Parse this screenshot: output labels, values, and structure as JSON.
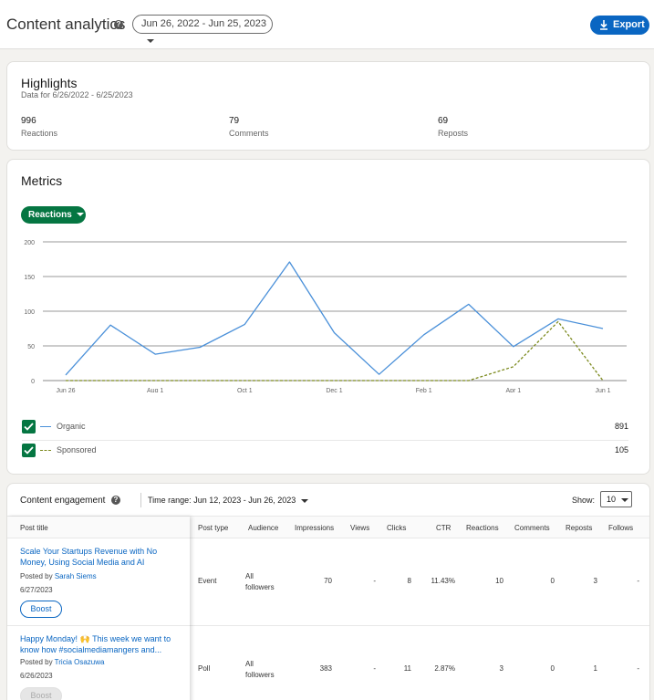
{
  "header": {
    "title": "Content analytics",
    "date_range": "Jun 26, 2022 - Jun 25, 2023",
    "export_label": "Export"
  },
  "highlights": {
    "title": "Highlights",
    "subtitle": "Data for 6/26/2022 - 6/25/2023",
    "stats": [
      {
        "value": "996",
        "label": "Reactions"
      },
      {
        "value": "79",
        "label": "Comments"
      },
      {
        "value": "69",
        "label": "Reposts"
      }
    ]
  },
  "metrics": {
    "title": "Metrics",
    "selected_metric": "Reactions",
    "legend": [
      {
        "name": "Organic",
        "total": "891",
        "color": "#4a90d9",
        "checked": true
      },
      {
        "name": "Sponsored",
        "total": "105",
        "color": "#7c8a1e",
        "checked": true
      }
    ]
  },
  "chart_data": {
    "type": "line",
    "ylim": [
      0,
      200
    ],
    "yticks": [
      0,
      50,
      100,
      150,
      200
    ],
    "x_tick_labels": [
      "Jun 26",
      "Aug 1",
      "Oct 1",
      "Dec 1",
      "Feb 1",
      "Apr 1",
      "Jun 1"
    ],
    "x_tick_positions": [
      0,
      2,
      4,
      6,
      8,
      10,
      12
    ],
    "series": [
      {
        "name": "Organic",
        "color": "#4a90d9",
        "dash": false,
        "x": [
          0,
          1,
          2,
          3,
          4,
          5,
          6,
          7,
          8,
          9,
          10,
          11,
          12
        ],
        "values": [
          8,
          80,
          38,
          48,
          81,
          171,
          69,
          9,
          66,
          110,
          49,
          89,
          75
        ]
      },
      {
        "name": "Sponsored",
        "color": "#7c8a1e",
        "dash": true,
        "x": [
          0,
          1,
          2,
          3,
          4,
          5,
          6,
          7,
          8,
          9,
          10,
          11,
          12
        ],
        "values": [
          0,
          0,
          0,
          0,
          0,
          0,
          0,
          0,
          0,
          0,
          20,
          85,
          0
        ]
      }
    ]
  },
  "engagement": {
    "title": "Content engagement",
    "time_range_label": "Time range:",
    "time_range": "Jun 12, 2023 - Jun 26, 2023",
    "show_label": "Show:",
    "show_value": "10",
    "columns": [
      "Post title",
      "Post type",
      "Audience",
      "Impressions",
      "Views",
      "Clicks",
      "CTR",
      "Reactions",
      "Comments",
      "Reposts",
      "Follows"
    ],
    "rows": [
      {
        "title": "Scale Your Startups Revenue with No Money, Using Social Media and AI",
        "posted_by_label": "Posted by",
        "author": "Sarah Siems",
        "date": "6/27/2023",
        "boost": "Boost",
        "type": "Event",
        "audience": "All followers",
        "impressions": "70",
        "views": "-",
        "clicks": "8",
        "ctr": "11.43%",
        "reactions": "10",
        "comments": "0",
        "reposts": "3",
        "follows": "-"
      },
      {
        "title": "Happy Monday! 🙌 This week we want to know how #socialmediamangers and...",
        "posted_by_label": "Posted by",
        "author": "Tricia Osazuwa",
        "date": "6/26/2023",
        "boost": "Boost",
        "type": "Poll",
        "audience": "All followers",
        "impressions": "383",
        "views": "-",
        "clicks": "11",
        "ctr": "2.87%",
        "reactions": "3",
        "comments": "0",
        "reposts": "1",
        "follows": "-"
      }
    ]
  }
}
